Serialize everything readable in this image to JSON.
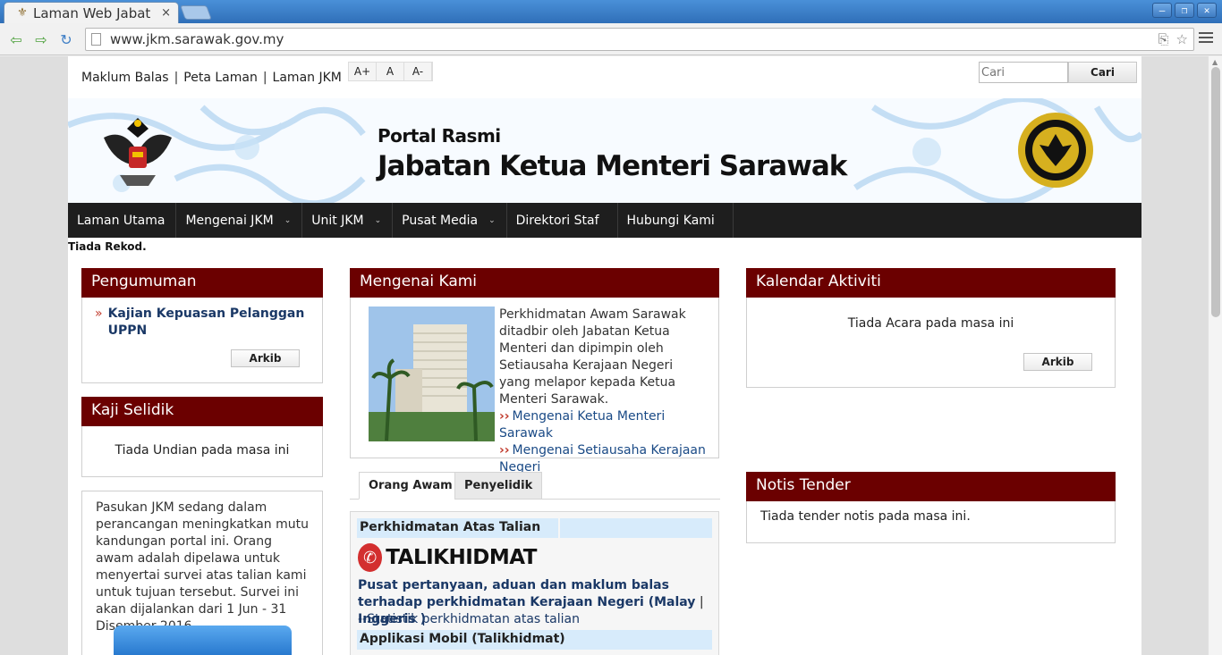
{
  "browser": {
    "tab_title": "Laman Web Jabat",
    "tab_close": "×",
    "url": "www.jkm.sarawak.gov.my",
    "colors": {
      "titlebar": "#3a7fc8",
      "accent": "#6b0000"
    }
  },
  "utility": {
    "links": [
      "Maklum Balas",
      "Peta Laman",
      "Laman JKM"
    ],
    "separator": "|",
    "font_controls": [
      "A+",
      "A",
      "A-"
    ],
    "search_placeholder": "Cari",
    "search_button": "Cari"
  },
  "banner": {
    "subtitle": "Portal Rasmi",
    "title": "Jabatan Ketua Menteri Sarawak"
  },
  "nav": {
    "items": [
      {
        "label": "Laman Utama",
        "has_dropdown": false
      },
      {
        "label": "Mengenai JKM",
        "has_dropdown": true
      },
      {
        "label": "Unit JKM",
        "has_dropdown": true
      },
      {
        "label": "Pusat Media",
        "has_dropdown": true
      },
      {
        "label": "Direktori Staf",
        "has_dropdown": false
      },
      {
        "label": "Hubungi Kami",
        "has_dropdown": false
      }
    ]
  },
  "notice": "Tiada Rekod.",
  "pengumuman": {
    "title": "Pengumuman",
    "items": [
      "Kajian Kepuasan Pelanggan UPPN"
    ],
    "arkib": "Arkib"
  },
  "kaji_selidik": {
    "title": "Kaji Selidik",
    "message": "Tiada Undian pada masa ini"
  },
  "survey": {
    "text": "Pasukan JKM sedang dalam perancangan meningkatkan mutu kandungan portal ini.  Orang awam adalah dipelawa untuk menyertai survei atas talian kami untuk tujuan tersebut. Survei ini akan dijalankan dari 1 Jun - 31 Disember 2016."
  },
  "mengenai": {
    "title": "Mengenai Kami",
    "text": "Perkhidmatan Awam Sarawak ditadbir oleh Jabatan Ketua Menteri dan dipimpin oleh Setiausaha Kerajaan Negeri yang melapor kepada Ketua Menteri Sarawak.",
    "links": [
      "Mengenai Ketua Menteri Sarawak",
      "Mengenai Setiausaha Kerajaan Negeri"
    ]
  },
  "tabs": {
    "items": [
      "Orang Awam",
      "Penyelidik"
    ],
    "active": "Orang Awam"
  },
  "services": {
    "head1": "Perkhidmatan Atas Talian",
    "logo_text": "TALIKHIDMAT",
    "desc_main": "Pusat pertanyaan, aduan dan maklum balas terhadap perkhidmatan Kerajaan Negeri (",
    "lang_malay": "Malay",
    "lang_sep": " | ",
    "lang_inggeris": "Inggeris",
    "desc_end": " )",
    "stat_link": "--Statistik perkhidmatan atas talian",
    "head2": "Applikasi Mobil (Talikhidmat)"
  },
  "kalendar": {
    "title": "Kalendar Aktiviti",
    "message": "Tiada Acara pada masa ini",
    "arkib": "Arkib"
  },
  "tender": {
    "title": "Notis Tender",
    "message": "Tiada tender notis pada masa ini."
  }
}
